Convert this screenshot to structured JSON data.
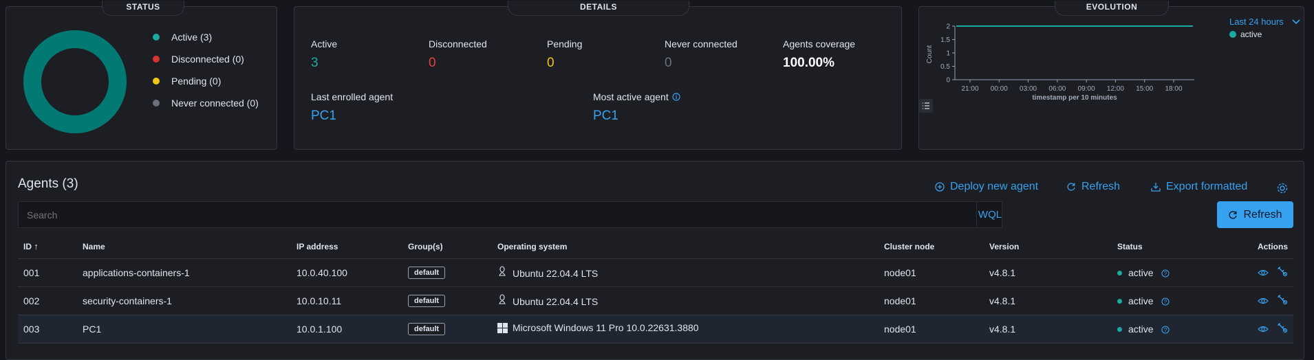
{
  "status": {
    "title": "STATUS",
    "legend": [
      {
        "label": "Active (3)",
        "color": "#1ba9a0"
      },
      {
        "label": "Disconnected (0)",
        "color": "#d4352e"
      },
      {
        "label": "Pending (0)",
        "color": "#f0c419"
      },
      {
        "label": "Never connected (0)",
        "color": "#6a717d"
      }
    ],
    "donut_color": "#027a73"
  },
  "details": {
    "title": "DETAILS",
    "stats": [
      {
        "label": "Active",
        "value": "3",
        "color": "#1ba9a0"
      },
      {
        "label": "Disconnected",
        "value": "0",
        "color": "#e5413c"
      },
      {
        "label": "Pending",
        "value": "0",
        "color": "#f6c21b"
      },
      {
        "label": "Never connected",
        "value": "0",
        "color": "#6a717d"
      },
      {
        "label": "Agents coverage",
        "value": "100.00%",
        "color": "#ffffff"
      }
    ],
    "last_enrolled_label": "Last enrolled agent",
    "last_enrolled_value": "PC1",
    "most_active_label": "Most active agent",
    "most_active_value": "PC1"
  },
  "evolution": {
    "title": "EVOLUTION",
    "range_label": "Last 24 hours",
    "legend_label": "active",
    "chart_data": {
      "type": "line",
      "x": [
        "21:00",
        "00:00",
        "03:00",
        "06:00",
        "09:00",
        "12:00",
        "15:00",
        "18:00"
      ],
      "series": [
        {
          "name": "active",
          "values": [
            2,
            2,
            2,
            2,
            2,
            2,
            2,
            2
          ]
        }
      ],
      "yticks": [
        "0",
        "0.5",
        "1",
        "1.5",
        "2"
      ],
      "ylim": [
        0,
        2
      ],
      "xlabel": "timestamp per 10 minutes",
      "ylabel": "Count"
    }
  },
  "agents": {
    "title": "Agents (3)",
    "deploy_label": "Deploy new agent",
    "refresh_link_label": "Refresh",
    "export_label": "Export formatted",
    "search_placeholder": "Search",
    "wql_label": "WQL",
    "refresh_button_label": "Refresh",
    "columns": [
      "ID",
      "Name",
      "IP address",
      "Group(s)",
      "Operating system",
      "Cluster node",
      "Version",
      "Status",
      "Actions"
    ],
    "rows": [
      {
        "id": "001",
        "name": "applications-containers-1",
        "ip": "10.0.40.100",
        "group": "default",
        "os": "Ubuntu 22.04.4 LTS",
        "os_icon": "linux-icon",
        "node": "node01",
        "version": "v4.8.1",
        "status": "active"
      },
      {
        "id": "002",
        "name": "security-containers-1",
        "ip": "10.0.10.11",
        "group": "default",
        "os": "Ubuntu 22.04.4 LTS",
        "os_icon": "linux-icon",
        "node": "node01",
        "version": "v4.8.1",
        "status": "active"
      },
      {
        "id": "003",
        "name": "PC1",
        "ip": "10.0.1.100",
        "group": "default",
        "os": "Microsoft Windows 11 Pro 10.0.22631.3880",
        "os_icon": "windows-icon",
        "node": "node01",
        "version": "v4.8.1",
        "status": "active"
      }
    ]
  }
}
